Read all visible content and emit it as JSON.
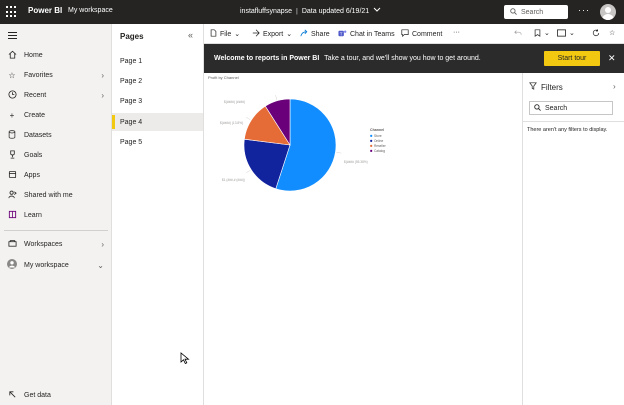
{
  "app": {
    "brand": "Power BI",
    "workspace": "My workspace",
    "report_name": "instafluffsynapse",
    "separator": "|",
    "data_updated": "Data updated 6/19/21",
    "search_label": "Search",
    "more": "···"
  },
  "nav": {
    "items": [
      {
        "label": "Home",
        "icon": "home-icon"
      },
      {
        "label": "Favorites",
        "icon": "star-icon"
      },
      {
        "label": "Recent",
        "icon": "clock-icon"
      },
      {
        "label": "Create",
        "icon": "plus-icon"
      },
      {
        "label": "Datasets",
        "icon": "database-icon"
      },
      {
        "label": "Goals",
        "icon": "trophy-icon"
      },
      {
        "label": "Apps",
        "icon": "apps-icon"
      },
      {
        "label": "Shared with me",
        "icon": "share-person-icon"
      },
      {
        "label": "Learn",
        "icon": "book-icon"
      },
      {
        "label": "Workspaces",
        "icon": "workspaces-icon"
      },
      {
        "label": "My workspace",
        "icon": "avatar-icon"
      }
    ],
    "get_data": "Get data"
  },
  "pages": {
    "title": "Pages",
    "items": [
      "Page 1",
      "Page 2",
      "Page 3",
      "Page 4",
      "Page 5"
    ],
    "active_index": 3
  },
  "toolbar": {
    "file": "File",
    "export": "Export",
    "share": "Share",
    "chat": "Chat in Teams",
    "comment": "Comment",
    "more": "···"
  },
  "banner": {
    "title": "Welcome to reports in Power BI",
    "text": "Take a tour, and we'll show you how to get around.",
    "button": "Start tour"
  },
  "filters": {
    "title": "Filters",
    "search_placeholder": "Search",
    "empty_text": "There aren't any filters to display."
  },
  "colors": {
    "accent": "#f2c811",
    "topbar": "#252423",
    "banner": "#2b2b2b"
  },
  "chart_data": {
    "type": "pie",
    "title": "Profit by Channel",
    "legend_title": "Channel",
    "legend_position": "right",
    "slices": [
      {
        "name": "Store",
        "value": 55,
        "color": "#118dff",
        "label": "$(#### (55.38%)"
      },
      {
        "name": "Online",
        "value": 22,
        "color": "#12239e",
        "label": "$1 (###,# (###))"
      },
      {
        "name": "Reseller",
        "value": 14,
        "color": "#e66c37",
        "label": "$(####) (13.8%)"
      },
      {
        "name": "Catalog",
        "value": 9,
        "color": "#6b007b",
        "label": "$(####) (####)"
      }
    ]
  }
}
